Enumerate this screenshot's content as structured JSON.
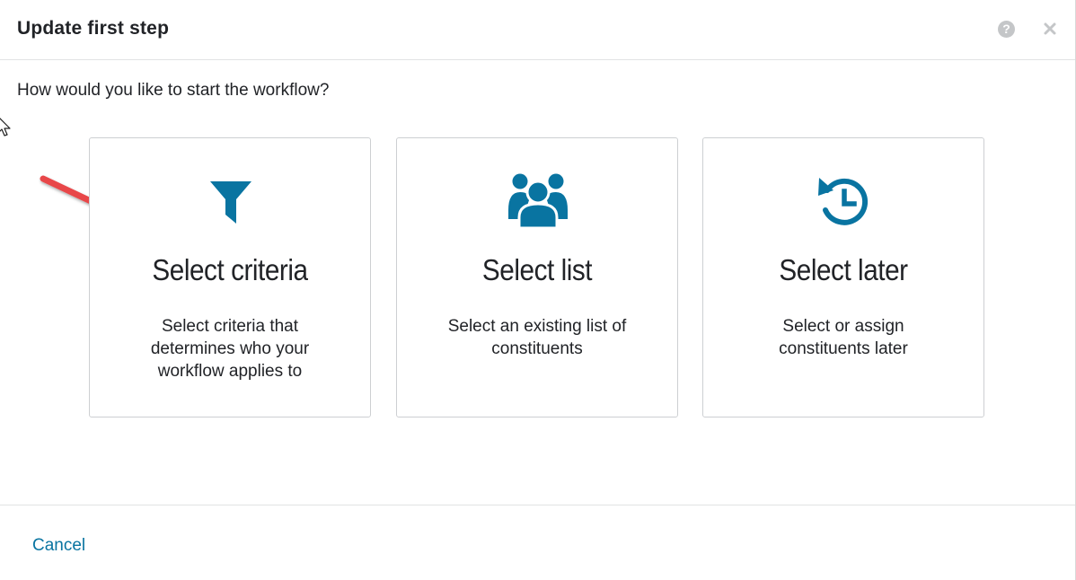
{
  "dialog": {
    "title": "Update first step",
    "help_icon": "question-circle-icon",
    "close_icon": "close-icon",
    "help_glyph": "?"
  },
  "prompt": "How would you like to start the workflow?",
  "options": [
    {
      "icon": "filter-icon",
      "title": "Select criteria",
      "description": "Select criteria that determines who your workflow applies to"
    },
    {
      "icon": "users-group-icon",
      "title": "Select list",
      "description": "Select an existing list of constituents"
    },
    {
      "icon": "history-clock-icon",
      "title": "Select later",
      "description": "Select or assign constituents later"
    }
  ],
  "footer": {
    "cancel_label": "Cancel"
  },
  "colors": {
    "accent": "#0974a1",
    "icon": "#0974a1",
    "annotation_arrow": "#e8474a",
    "text": "#212327",
    "border": "#cdcfd2"
  }
}
